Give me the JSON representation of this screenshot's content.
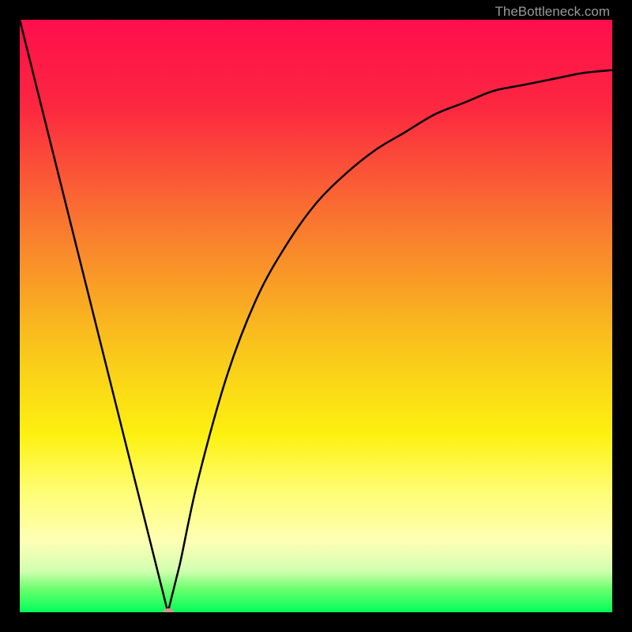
{
  "watermark": "TheBottleneck.com",
  "chart_data": {
    "type": "line",
    "title": "",
    "xlabel": "",
    "ylabel": "",
    "xlim": [
      0,
      100
    ],
    "ylim": [
      0,
      100
    ],
    "gradient": {
      "stops": [
        {
          "offset": 0,
          "color": "#ff0e4c"
        },
        {
          "offset": 15,
          "color": "#fc2840"
        },
        {
          "offset": 35,
          "color": "#f97a2f"
        },
        {
          "offset": 55,
          "color": "#f9c41c"
        },
        {
          "offset": 70,
          "color": "#fdf110"
        },
        {
          "offset": 80,
          "color": "#fefe77"
        },
        {
          "offset": 88,
          "color": "#feffb5"
        },
        {
          "offset": 93,
          "color": "#d2ffb0"
        },
        {
          "offset": 96,
          "color": "#6eff70"
        },
        {
          "offset": 100,
          "color": "#00ff59"
        }
      ]
    },
    "series": [
      {
        "name": "bottleneck-curve",
        "description": "V-shaped curve with minimum near x=25",
        "x": [
          0,
          5,
          10,
          15,
          20,
          23,
          25,
          27,
          30,
          35,
          40,
          45,
          50,
          55,
          60,
          65,
          70,
          75,
          80,
          85,
          90,
          95,
          100
        ],
        "y": [
          100,
          82,
          63,
          44,
          24,
          8,
          0,
          8,
          22,
          40,
          53,
          62,
          69,
          74,
          78,
          81,
          84,
          86,
          88,
          89,
          90,
          91,
          91.5
        ]
      }
    ],
    "marker": {
      "x": 25,
      "y": 0,
      "color": "#d6938a"
    }
  }
}
